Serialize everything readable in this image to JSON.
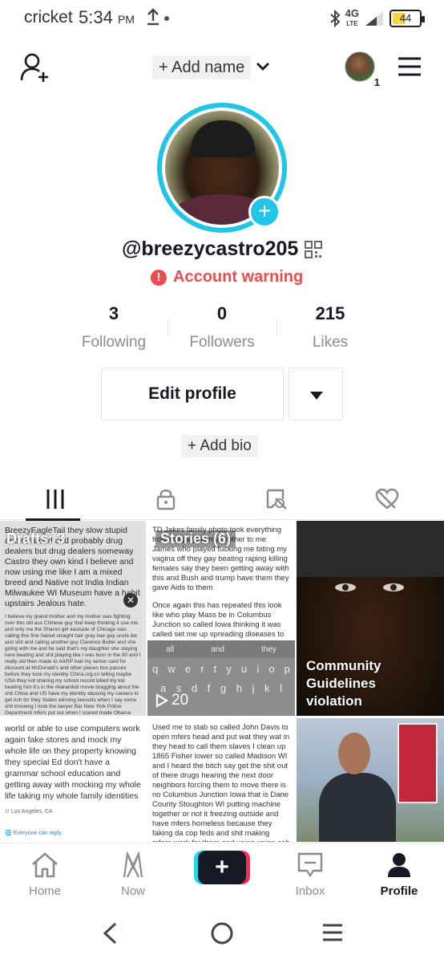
{
  "status_bar": {
    "carrier": "cricket",
    "time": "5:34",
    "ampm": "PM",
    "network": "4G",
    "network_sub": "LTE",
    "battery": "44"
  },
  "top_nav": {
    "add_name_label": "+ Add name",
    "account_badge": "1"
  },
  "profile": {
    "username": "@breezycastro205",
    "warning": "Account warning",
    "stats": [
      {
        "value": "3",
        "label": "Following"
      },
      {
        "value": "0",
        "label": "Followers"
      },
      {
        "value": "215",
        "label": "Likes"
      }
    ],
    "edit_profile_label": "Edit profile",
    "add_bio_label": "+ Add bio"
  },
  "tabs": [
    {
      "icon": "grid-icon",
      "active": true
    },
    {
      "icon": "lock-icon",
      "active": false
    },
    {
      "icon": "tagged-icon",
      "active": false
    },
    {
      "icon": "liked-icon",
      "active": false
    }
  ],
  "grid": {
    "drafts_label": "Drafts: 3",
    "stories_label": "Stories (6)",
    "views_count": "20",
    "violation_label": "Community Guidelines violation",
    "cell1_text_top": "BreezyEagleTail they slow stupid and retarded and probably drug dealers but drug dealers someway Castro they own kind I believe and now using me like I am a mixed breed and Native not India Indian Milwaukee WI Museum have a habit upstairs Jealous hate.",
    "cell1_text_mid": "I believe my grand mother and my mother was fighting over this old ass Chinese guy that keep thinking it use me and only me the Sharon girl eastside of Chicago was calling this fine haired straight hair gray hair guy uncle ike and shit and calling another guy Clarence Butler and she going with me and he said that's my daughter she staying here beating and shit playing like I was born in the 80 and I really old then made to AARP had my senior card for discount at McDonald's and other places bus passes before they took my identity China.org.cn telling maybe USA they not sharing my school record killed my kid beating him it's in the #karanikid movie bragging about the shit China and US have my identity abusing my careers to get rich for they States winning lawsuits when I say some shit knowing I took the lawyer Bar New York Police Department mfers put out when I scared made Obama they knew they was all lying about",
    "cell2_text_top": "TD Jakes family photo took everything from me playing my brother to me James who played fucking me biting my vagina off they gay beating raping killing females say they been getting away with this and Bush and trump have them they gave Aids to them",
    "cell2_text_mid": "Once again this has repeated this look like who play Mass be in Columbus Junction so called Iowa thinking it was called set me up spreading diseases to use Blue Cross Blue Shield insurance of mine America don't have health insurance China or Japan told them how it works and give shit to me",
    "keyboard_suggestions": [
      "all",
      "and",
      "they"
    ],
    "keyboard_row1": [
      "q",
      "w",
      "e",
      "r",
      "t",
      "y",
      "u",
      "i",
      "o",
      "p"
    ],
    "keyboard_row2": [
      "a",
      "s",
      "d",
      "f",
      "g",
      "h",
      "j",
      "k",
      "l"
    ],
    "cell4_text": "world or able to use computers work again fake stores and mock my whole life on they property knowing they special Ed don't have a grammar school education and getting away with mocking my whole life taking my whole family identities",
    "cell4_location": "Los Angeles, CA",
    "cell4_reply": "Everyone can reply",
    "cell5_text": "Used me to stab so called John Davis to open mfers head and put wat they wat in they head to call them slaves I clean up 1865 Fisher lower so called Madison WI and I heard the bitch say get the shit out of there drugs hearing the next door neighbors forcing them to move there is no Columbus Junction Iowa that is Dane County Stoughton WI putting machine together or not it freezing outside and have mfers homeless because they faking da cop feds and shit making mfers work for them and using union cab company others like non emergency transportation so called"
  },
  "bottom_nav": [
    {
      "label": "Home",
      "icon": "home-icon"
    },
    {
      "label": "Now",
      "icon": "now-icon"
    },
    {
      "label": "Inbox",
      "icon": "inbox-icon"
    },
    {
      "label": "Profile",
      "icon": "profile-icon"
    }
  ],
  "colors": {
    "accent_cyan": "#20c5e8",
    "warning_red": "#ee4d4d",
    "brand_pink": "#fe2c55",
    "text_dark": "#161823",
    "text_gray": "#8a8b91"
  }
}
